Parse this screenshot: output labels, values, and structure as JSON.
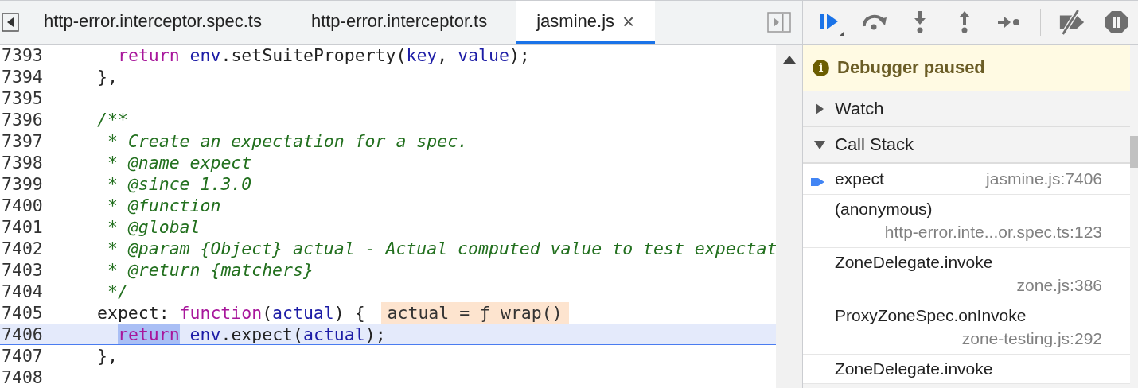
{
  "editor": {
    "tabs": [
      {
        "label": "http-error.interceptor.spec.ts",
        "selected": false
      },
      {
        "label": "http-error.interceptor.ts",
        "selected": false
      },
      {
        "label": "jasmine.js",
        "selected": true,
        "closable": true
      }
    ],
    "close_glyph": "×",
    "lines": [
      {
        "number": "7393",
        "current": false,
        "kind": "statement",
        "tokens": [
          {
            "text": "return",
            "kind": "keyword"
          },
          {
            "text": " env",
            "kind": "variable"
          },
          {
            "text": ".setSuiteProperty(",
            "kind": "plain"
          },
          {
            "text": "key",
            "kind": "variable"
          },
          {
            "text": ", ",
            "kind": "plain"
          },
          {
            "text": "value",
            "kind": "variable"
          },
          {
            "text": ");",
            "kind": "plain"
          }
        ]
      },
      {
        "number": "7394",
        "current": false,
        "kind": "member",
        "tokens": [
          {
            "text": "},",
            "kind": "plain"
          }
        ]
      },
      {
        "number": "7395",
        "current": false
      },
      {
        "number": "7396",
        "current": false,
        "kind": "member",
        "tokens": [
          {
            "text": "/**",
            "kind": "comment"
          }
        ]
      },
      {
        "number": "7397",
        "current": false,
        "kind": "doc",
        "tokens": [
          {
            "text": "* Create an expectation for a spec.",
            "kind": "comment"
          }
        ]
      },
      {
        "number": "7398",
        "current": false,
        "kind": "doc",
        "tokens": [
          {
            "text": "* @name expect",
            "kind": "comment"
          }
        ]
      },
      {
        "number": "7399",
        "current": false,
        "kind": "doc",
        "tokens": [
          {
            "text": "* @since 1.3.0",
            "kind": "comment"
          }
        ]
      },
      {
        "number": "7400",
        "current": false,
        "kind": "doc",
        "tokens": [
          {
            "text": "* @function",
            "kind": "comment"
          }
        ]
      },
      {
        "number": "7401",
        "current": false,
        "kind": "doc",
        "tokens": [
          {
            "text": "* @global",
            "kind": "comment"
          }
        ]
      },
      {
        "number": "7402",
        "current": false,
        "kind": "doc",
        "tokens": [
          {
            "text": "* @param {Object} actual - Actual computed value to test expectat",
            "kind": "comment"
          }
        ]
      },
      {
        "number": "7403",
        "current": false,
        "kind": "doc",
        "tokens": [
          {
            "text": "* @return {matchers}",
            "kind": "comment"
          }
        ]
      },
      {
        "number": "7404",
        "current": false,
        "kind": "doc",
        "tokens": [
          {
            "text": "*/",
            "kind": "comment"
          }
        ]
      },
      {
        "number": "7405",
        "current": false,
        "kind": "member",
        "tokens": [
          {
            "text": "expect: ",
            "kind": "plain"
          },
          {
            "text": "function",
            "kind": "keyword"
          },
          {
            "text": "(",
            "kind": "plain"
          },
          {
            "text": "actual",
            "kind": "variable"
          },
          {
            "text": ") {",
            "kind": "plain"
          }
        ],
        "inline_value": "actual = ƒ wrap()"
      },
      {
        "number": "7406",
        "current": true,
        "kind": "statement",
        "tokens": [
          {
            "text": "return",
            "kind": "paused"
          },
          {
            "text": " env",
            "kind": "variable"
          },
          {
            "text": ".expect(",
            "kind": "plain"
          },
          {
            "text": "actual",
            "kind": "variable"
          },
          {
            "text": ");",
            "kind": "plain"
          }
        ]
      },
      {
        "number": "7407",
        "current": false,
        "kind": "member",
        "tokens": [
          {
            "text": "},",
            "kind": "plain"
          }
        ]
      },
      {
        "number": "7408",
        "current": false
      }
    ]
  },
  "debugger": {
    "toolbar": [
      {
        "kind": "resume"
      },
      {
        "kind": "step-over"
      },
      {
        "kind": "step-into"
      },
      {
        "kind": "step-out"
      },
      {
        "kind": "step"
      },
      {
        "kind": "deactivate"
      },
      {
        "kind": "pause-exceptions"
      }
    ],
    "banner": {
      "icon": "i",
      "text": "Debugger paused"
    },
    "sections": [
      {
        "title": "Watch",
        "expanded": false
      },
      {
        "title": "Call Stack",
        "expanded": true
      }
    ],
    "call_stack": [
      {
        "name": "expect",
        "location": "jasmine.js:7406",
        "selected": true
      },
      {
        "name": "(anonymous)",
        "location": "http-error.inte...or.spec.ts:123",
        "selected": false
      },
      {
        "name": "ZoneDelegate.invoke",
        "location": "zone.js:386",
        "selected": false
      },
      {
        "name": "ProxyZoneSpec.onInvoke",
        "location": "zone-testing.js:292",
        "selected": false
      },
      {
        "name": "ZoneDelegate.invoke",
        "selected": false
      }
    ]
  }
}
